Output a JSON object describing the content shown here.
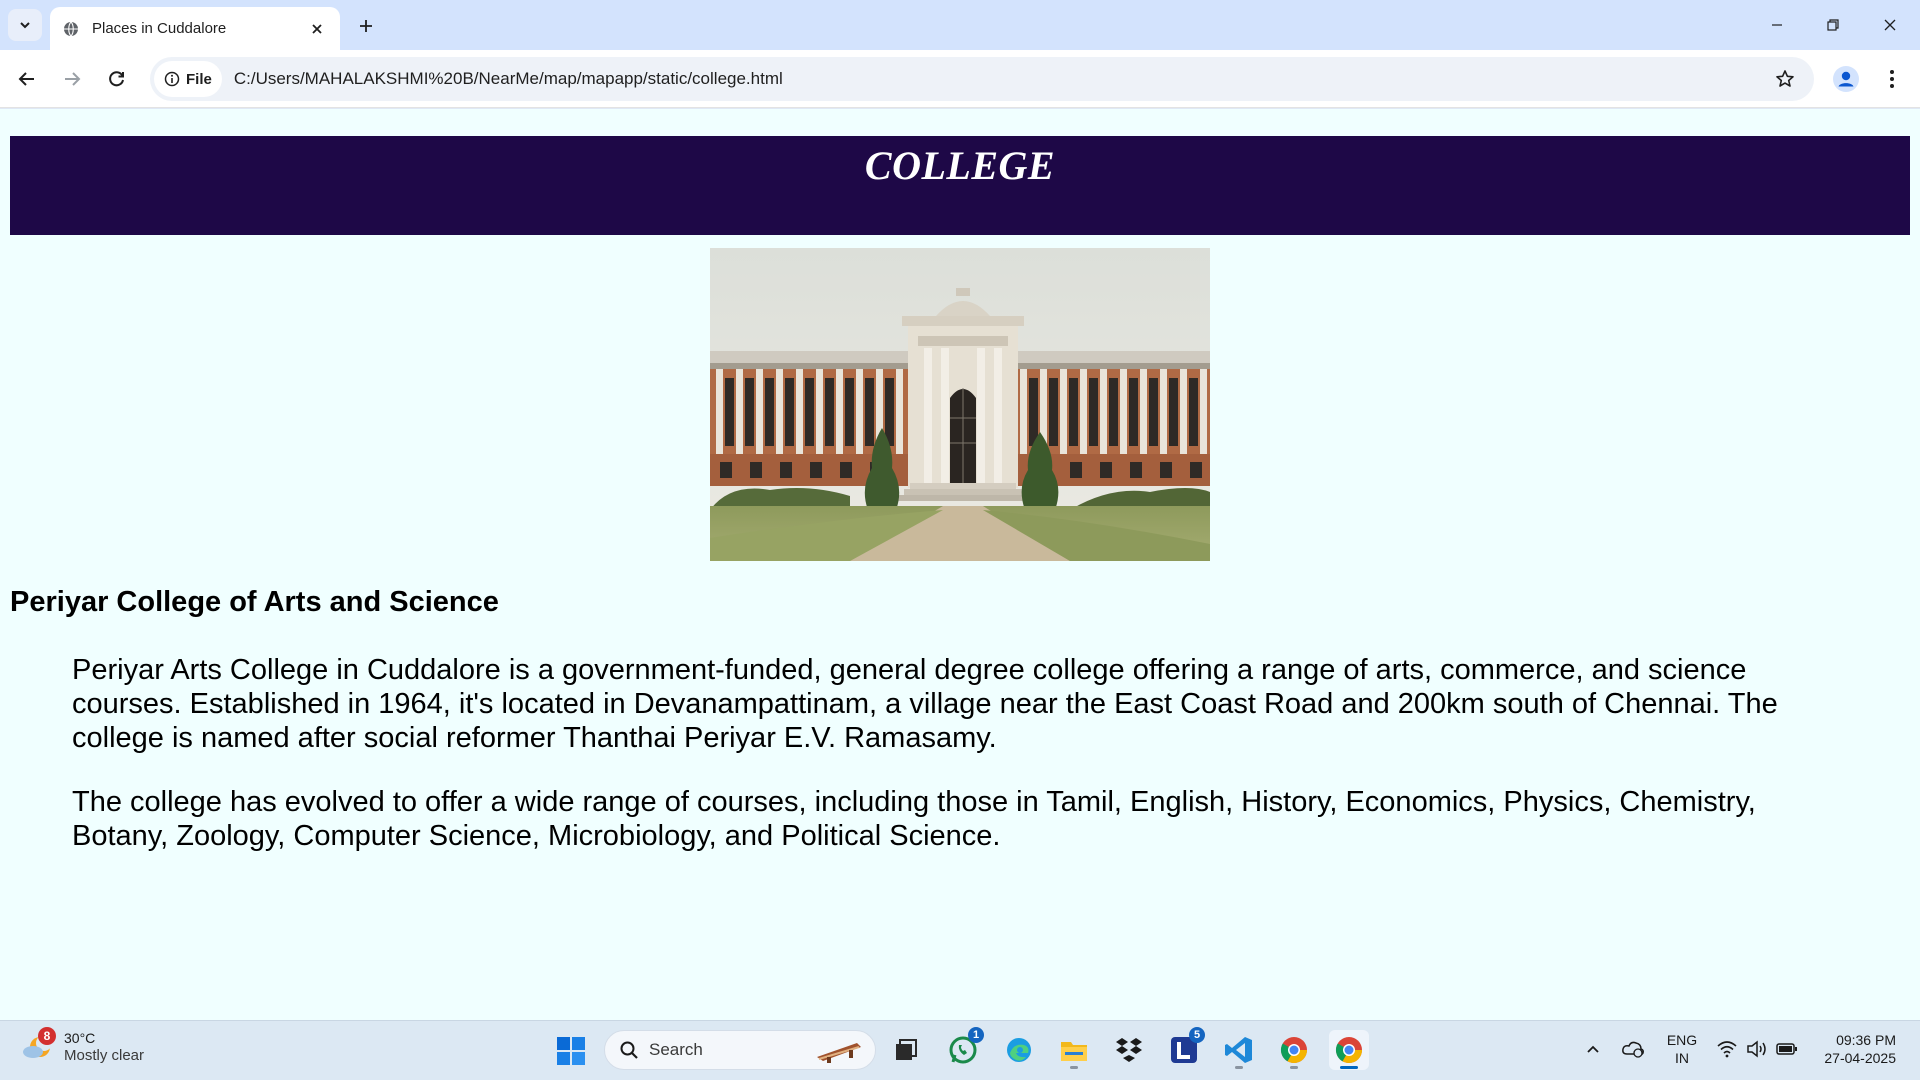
{
  "browser": {
    "tab_title": "Places in Cuddalore",
    "site_chip_label": "File",
    "url": "C:/Users/MAHALAKSHMI%20B/NearMe/map/mapapp/static/college.html"
  },
  "page": {
    "header_title": "COLLEGE",
    "college_name": "Periyar College of Arts and Science",
    "paragraphs": [
      "Periyar Arts College in Cuddalore is a government-funded, general degree college offering a range of arts, commerce, and science courses. Established in 1964, it's located in Devanampattinam, a village near the East Coast Road and 200km south of Chennai. The college is named after social reformer Thanthai Periyar E.V. Ramasamy.",
      "The college has evolved to offer a wide range of courses, including those in Tamil, English, History, Economics, Physics, Chemistry, Botany, Zoology, Computer Science, Microbiology, and Political Science."
    ],
    "colors": {
      "header_bg": "#1e0847",
      "page_bg": "#f0ffff"
    }
  },
  "taskbar": {
    "weather": {
      "badge": "8",
      "temp": "30°C",
      "condition": "Mostly clear"
    },
    "search_label": "Search",
    "apps": [
      {
        "name": "task-view",
        "badge": ""
      },
      {
        "name": "whatsapp",
        "badge": "1"
      },
      {
        "name": "edge",
        "badge": ""
      },
      {
        "name": "file-explorer",
        "badge": ""
      },
      {
        "name": "dropbox",
        "badge": ""
      },
      {
        "name": "l-app",
        "badge": "5"
      },
      {
        "name": "vscode",
        "badge": ""
      },
      {
        "name": "chrome",
        "badge": ""
      },
      {
        "name": "chrome-active",
        "badge": ""
      }
    ],
    "language": {
      "line1": "ENG",
      "line2": "IN"
    },
    "clock": {
      "time": "09:36 PM",
      "date": "27-04-2025"
    }
  }
}
